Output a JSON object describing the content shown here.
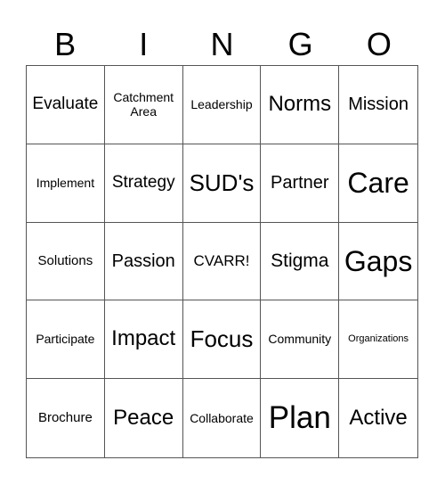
{
  "header": {
    "letters": [
      "B",
      "I",
      "N",
      "G",
      "O"
    ]
  },
  "grid": {
    "rows": [
      [
        "Evaluate",
        "Catchment Area",
        "Leadership",
        "Norms",
        "Mission"
      ],
      [
        "Implement",
        "Strategy",
        "SUD's",
        "Partner",
        "Care"
      ],
      [
        "Solutions",
        "Passion",
        "CVARR!",
        "Stigma",
        "Gaps"
      ],
      [
        "Participate",
        "Impact",
        "Focus",
        "Community",
        "Organizations"
      ],
      [
        "Brochure",
        "Peace",
        "Collaborate",
        "Plan",
        "Active"
      ]
    ]
  }
}
